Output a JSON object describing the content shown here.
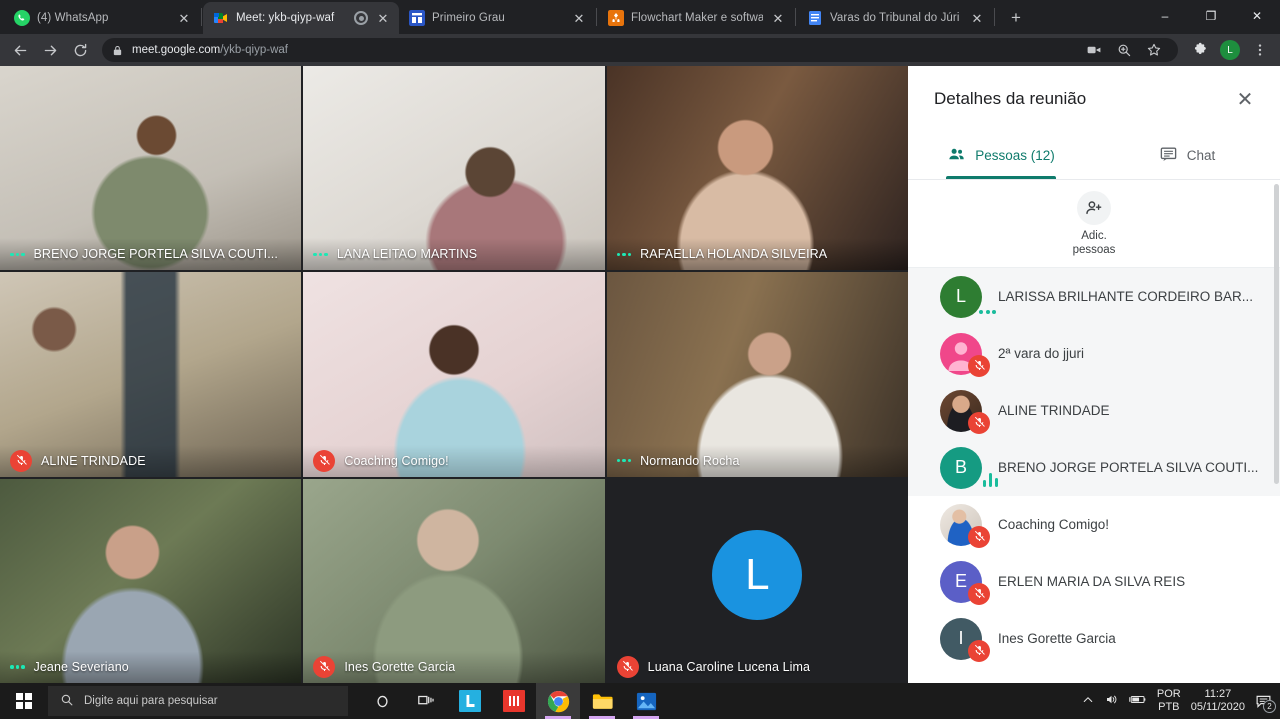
{
  "browser": {
    "tabs": [
      {
        "title": "(4) WhatsApp",
        "favicon": "whatsapp-icon",
        "active": false,
        "recording": false
      },
      {
        "title": "Meet: ykb-qiyp-waf",
        "favicon": "google-meet-icon",
        "active": true,
        "recording": true
      },
      {
        "title": "Primeiro Grau",
        "favicon": "primeiro-grau-icon",
        "active": false,
        "recording": false
      },
      {
        "title": "Flowchart Maker e software de",
        "favicon": "drawio-icon",
        "active": false,
        "recording": false
      },
      {
        "title": "Varas do Tribunal do Júri - Sess",
        "favicon": "docs-icon",
        "active": false,
        "recording": false
      }
    ],
    "new_tab_label": "+",
    "window_controls": {
      "minimize": "–",
      "maximize": "❐",
      "close": "✕"
    },
    "nav": {
      "back": "back-arrow-icon",
      "forward": "forward-arrow-icon",
      "reload": "reload-icon"
    },
    "omnibox": {
      "lock": "lock-icon",
      "domain": "meet.google.com",
      "path": "/ykb-qiyp-waf"
    },
    "toolbar_actions": [
      "camera-icon",
      "zoom-icon",
      "bookmark-star-icon",
      "extensions-puzzle-icon"
    ],
    "profile_initial": "L",
    "menu": "kebab-menu-icon",
    "accent": "#1e8e3e"
  },
  "meet": {
    "tiles": [
      {
        "name": "BRENO JORGE PORTELA SILVA COUTI...",
        "status": "speaking-dots",
        "has_video": true,
        "bg": "#cfcac2",
        "initial": "",
        "initial_bg": ""
      },
      {
        "name": "LANA LEITAO MARTINS",
        "status": "speaking-dots",
        "has_video": true,
        "bg": "#d8d4cf",
        "initial": "",
        "initial_bg": ""
      },
      {
        "name": "RAFAELLA HOLANDA SILVEIRA",
        "status": "speaking-dots",
        "has_video": true,
        "bg": "#6b4a3c",
        "initial": "",
        "initial_bg": ""
      },
      {
        "name": "ALINE TRINDADE",
        "status": "muted",
        "has_video": true,
        "bg": "#b9a98e",
        "initial": "",
        "initial_bg": ""
      },
      {
        "name": "Coaching Comigo!",
        "status": "muted",
        "has_video": true,
        "bg": "#e3d3d4",
        "initial": "",
        "initial_bg": ""
      },
      {
        "name": "Normando Rocha",
        "status": "speaking-dots",
        "has_video": true,
        "bg": "#7b6a56",
        "initial": "",
        "initial_bg": ""
      },
      {
        "name": "Jeane Severiano",
        "status": "speaking-dots",
        "has_video": true,
        "bg": "#5c6b4f",
        "initial": "",
        "initial_bg": ""
      },
      {
        "name": "Ines Gorette Garcia",
        "status": "muted",
        "has_video": true,
        "bg": "#8e9a82",
        "initial": "",
        "initial_bg": ""
      },
      {
        "name": "Luana Caroline Lucena Lima",
        "status": "muted",
        "has_video": false,
        "bg": "#202124",
        "initial": "L",
        "initial_bg": "#1a93e0"
      }
    ]
  },
  "panel": {
    "title": "Detalhes da reunião",
    "close_label": "✕",
    "tabs": [
      {
        "label": "Pessoas (12)",
        "icon": "people-icon",
        "selected": true
      },
      {
        "label": "Chat",
        "icon": "chat-icon",
        "selected": false
      }
    ],
    "add_people": {
      "icon": "person-add-icon",
      "line1": "Adic.",
      "line2": "pessoas"
    },
    "participants": [
      {
        "name": "LARISSA BRILHANTE CORDEIRO BAR...",
        "initial": "L",
        "color": "#2e7d32",
        "avatar_type": "initial",
        "status": "speaking-dots",
        "hover": true
      },
      {
        "name": "2ª vara do jjuri",
        "initial": "",
        "color": "#f0478a",
        "avatar_type": "person-glyph",
        "status": "muted",
        "hover": true
      },
      {
        "name": "ALINE TRINDADE",
        "initial": "",
        "color": "#7a4a3a",
        "avatar_type": "photo",
        "status": "muted",
        "hover": true
      },
      {
        "name": "BRENO JORGE PORTELA SILVA COUTI...",
        "initial": "B",
        "color": "#159b82",
        "avatar_type": "initial",
        "status": "speaking-bars",
        "hover": true
      },
      {
        "name": "Coaching Comigo!",
        "initial": "",
        "color": "#c8c2bb",
        "avatar_type": "photo",
        "status": "muted",
        "hover": false
      },
      {
        "name": "ERLEN MARIA DA SILVA REIS",
        "initial": "E",
        "color": "#5b5fc7",
        "avatar_type": "initial",
        "status": "muted",
        "hover": false
      },
      {
        "name": "Ines Gorette Garcia",
        "initial": "I",
        "color": "#415a64",
        "avatar_type": "initial",
        "status": "muted",
        "hover": false
      }
    ],
    "accent": "#0f7b6c",
    "mute_color": "#ea4335",
    "active_color": "#1abc9c"
  },
  "taskbar": {
    "start": "windows-start-icon",
    "search_placeholder": "Digite aqui para pesquisar",
    "search_icon": "search-icon",
    "apps": [
      {
        "name": "cortana-icon",
        "running": false,
        "active": false
      },
      {
        "name": "task-view-icon",
        "running": false,
        "active": false
      },
      {
        "name": "app-l-icon",
        "running": false,
        "active": false
      },
      {
        "name": "app-red-icon",
        "running": false,
        "active": false
      },
      {
        "name": "google-chrome-icon",
        "running": true,
        "active": true
      },
      {
        "name": "file-explorer-icon",
        "running": true,
        "active": false
      },
      {
        "name": "photos-icon",
        "running": true,
        "active": false
      }
    ],
    "tray": {
      "chevron": "show-hidden-icons-icon",
      "volume": "volume-icon",
      "battery": "battery-icon",
      "lang_line1": "POR",
      "lang_line2": "PTB",
      "time": "11:27",
      "date": "05/11/2020",
      "notifications_icon": "action-center-icon",
      "notifications_count": "2"
    }
  }
}
